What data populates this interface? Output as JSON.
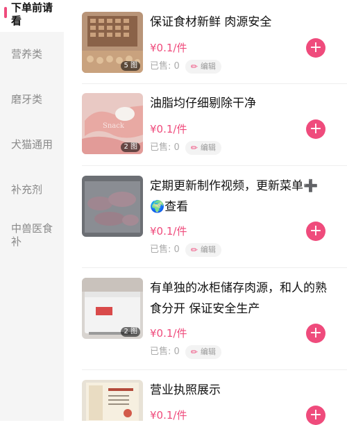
{
  "sidebar": {
    "categories": [
      {
        "label": "下单前请看"
      },
      {
        "label": "营养类"
      },
      {
        "label": "磨牙类"
      },
      {
        "label": "犬猫通用"
      },
      {
        "label": "补充剂"
      },
      {
        "label": "中兽医食补"
      }
    ],
    "active_color": "#ef4b7c"
  },
  "products": [
    {
      "title": "保证食材新鲜 肉源安全",
      "price": "¥0.1/件",
      "sold": "已售: 0",
      "edit_label": "编辑",
      "image_count": "5 图",
      "add_icon": "plus-icon"
    },
    {
      "title": "油脂均仔细剔除干净",
      "price": "¥0.1/件",
      "sold": "已售: 0",
      "edit_label": "编辑",
      "image_count": "2 图",
      "add_icon": "plus-icon"
    },
    {
      "title": "定期更新制作视频，更新菜单➕🌍查看",
      "price": "¥0.1/件",
      "sold": "已售: 0",
      "edit_label": "编辑",
      "image_count": "",
      "add_icon": "plus-icon"
    },
    {
      "title": "有单独的冰柜储存肉源，和人的熟食分开 保证安全生产",
      "price": "¥0.1/件",
      "sold": "已售: 0",
      "edit_label": "编辑",
      "image_count": "2 图",
      "add_icon": "plus-icon"
    },
    {
      "title": "营业执照展示",
      "price": "¥0.1/件",
      "sold": "",
      "edit_label": "",
      "image_count": "",
      "add_icon": "plus-icon"
    }
  ],
  "colors": {
    "accent": "#ef4b7c",
    "sidebar_bg": "#f5f5f5",
    "muted_text": "#aaaaaa"
  }
}
